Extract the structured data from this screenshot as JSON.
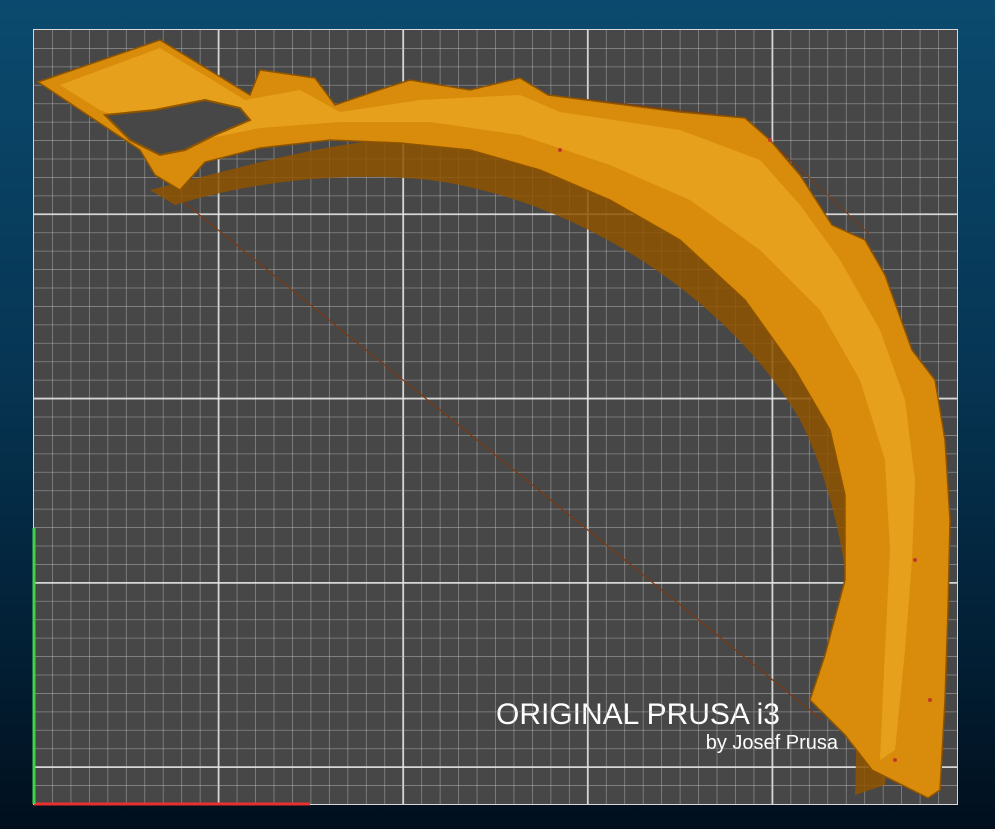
{
  "viewport": {
    "background_top": "#0b4a6e",
    "background_bottom": "#010f1d"
  },
  "bed": {
    "surface_color": "#474747",
    "grid_color": "#bdbdbd",
    "grid_major_color": "#e6e6e6",
    "logo_brand": "ORIGINAL PRUSA i3",
    "logo_author": "by Josef Prusa"
  },
  "axes": {
    "x_axis_color": "#e83030",
    "y_axis_color": "#3fd24a"
  },
  "model": {
    "filament_color": "#d98c0b",
    "shade_color": "#8f5400",
    "highlight_color": "#f2b12a",
    "travel_move_color": "#7a3a12"
  }
}
